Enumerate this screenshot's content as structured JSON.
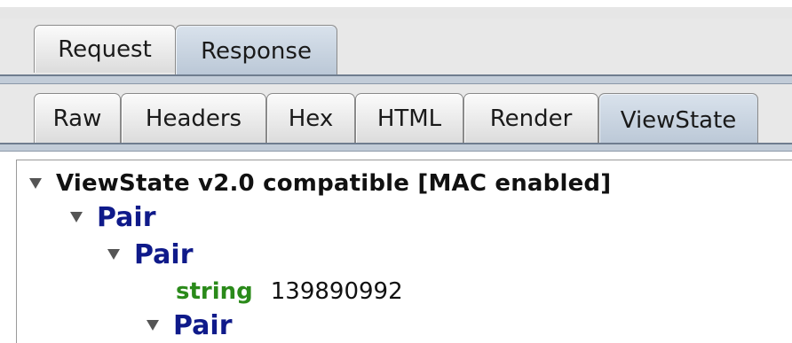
{
  "outer_tabs": [
    {
      "label": "Request",
      "active": false
    },
    {
      "label": "Response",
      "active": true
    }
  ],
  "inner_tabs": [
    {
      "label": "Raw",
      "active": false
    },
    {
      "label": "Headers",
      "active": false
    },
    {
      "label": "Hex",
      "active": false
    },
    {
      "label": "HTML",
      "active": false
    },
    {
      "label": "Render",
      "active": false
    },
    {
      "label": "ViewState",
      "active": true
    }
  ],
  "tree": {
    "root_label": "ViewState v2.0 compatible  [MAC enabled]",
    "nodes": [
      {
        "label": "Pair",
        "expanded": true
      },
      {
        "label": "Pair",
        "expanded": true
      },
      {
        "type": "string",
        "value": "139890992"
      },
      {
        "label": "Pair",
        "expanded": true
      }
    ]
  },
  "colors": {
    "pair_node": "#0f1a8a",
    "type_label": "#2a8a1a",
    "active_tab": "#c2ccd8"
  }
}
